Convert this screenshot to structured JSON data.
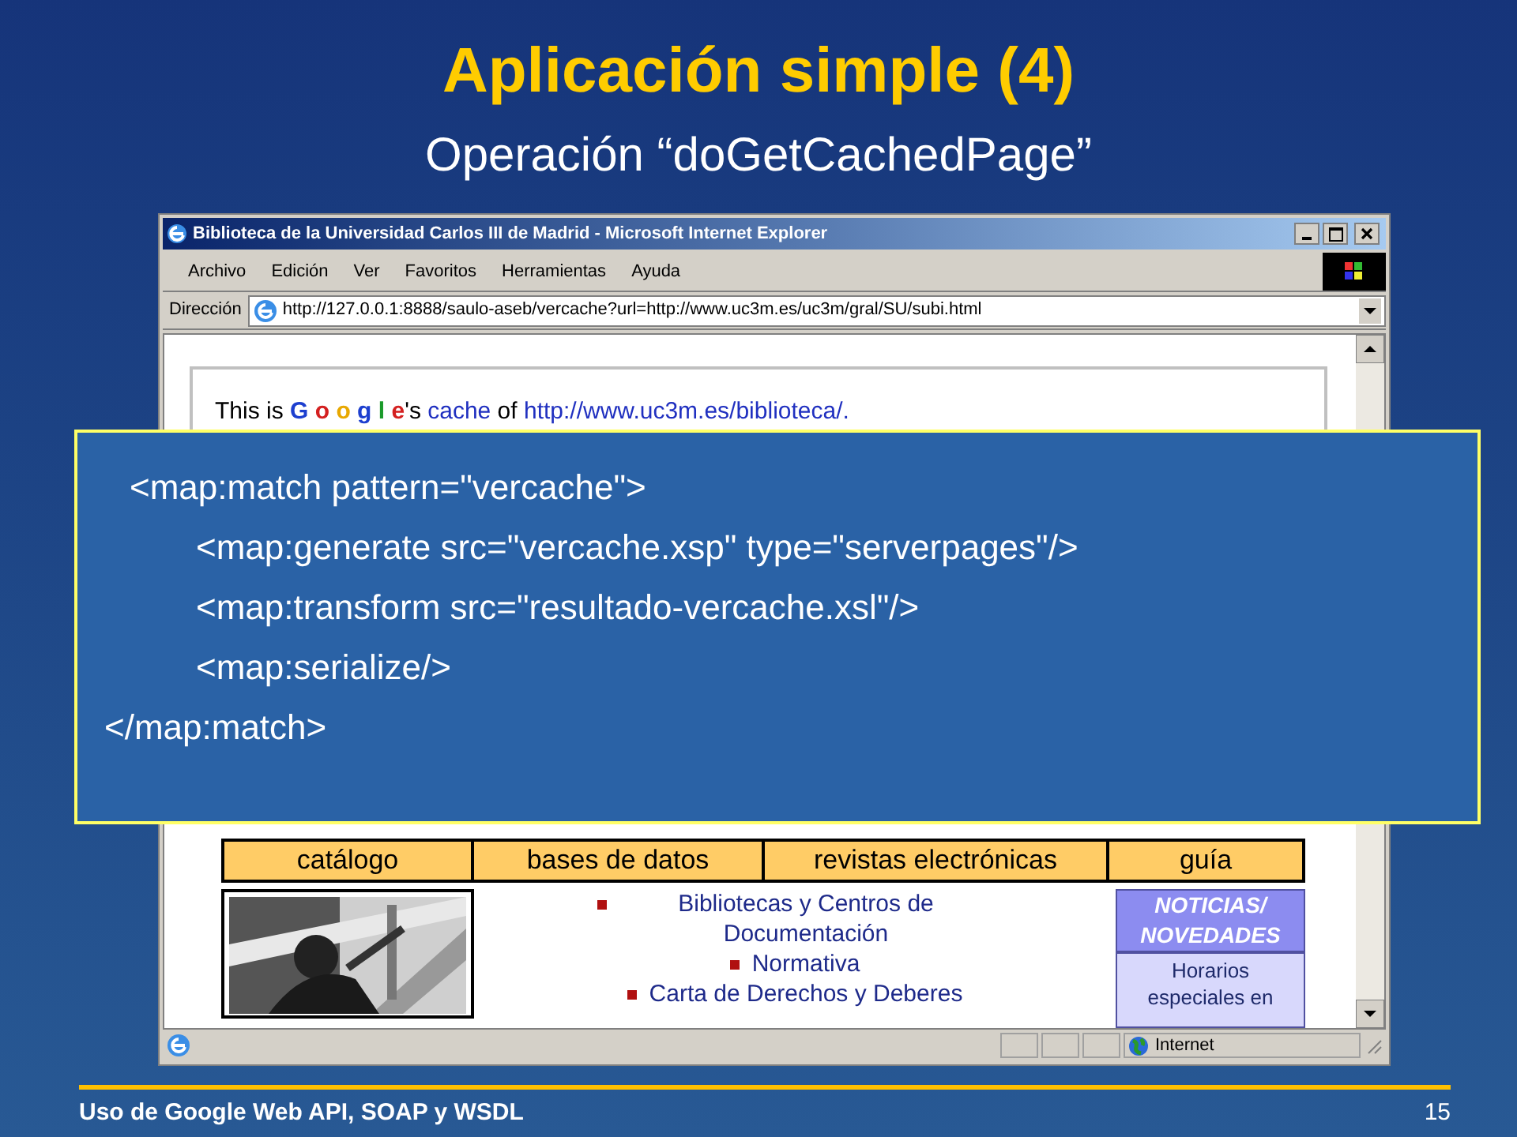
{
  "slide": {
    "title": "Aplicación simple (4)",
    "subtitle": "Operación “doGetCachedPage”"
  },
  "browser": {
    "title": "Biblioteca de la Universidad Carlos III de Madrid - Microsoft Internet Explorer",
    "menu": [
      "Archivo",
      "Edición",
      "Ver",
      "Favoritos",
      "Herramientas",
      "Ayuda"
    ],
    "address_label": "Dirección",
    "address": "http://127.0.0.1:8888/saulo-aseb/vercache?url=http://www.uc3m.es/uc3m/gral/SU/subi.html",
    "cache_line": {
      "prefix": "This is",
      "letters": [
        {
          "text": "G",
          "color": "#1d3fcf"
        },
        {
          "text": "o",
          "color": "#d42020"
        },
        {
          "text": "o",
          "color": "#e8a800"
        },
        {
          "text": "g",
          "color": "#1d3fcf"
        },
        {
          "text": "l",
          "color": "#1a9a2a"
        },
        {
          "text": "e",
          "color": "#d42020"
        }
      ],
      "suffix": "'s",
      "link": "cache",
      "middle": "of",
      "url": "http://www.uc3m.es/biblioteca/."
    },
    "nav_tabs": [
      "catálogo",
      "bases de datos",
      "revistas electrónicas",
      "guía"
    ],
    "links": [
      "Bibliotecas y Centros de Documentación",
      "Normativa",
      "Carta de Derechos y Deberes"
    ],
    "news": {
      "heading": "NOTICIAS/ NOVEDADES",
      "text": "Horarios especiales en"
    },
    "status_zone": "Internet"
  },
  "code": {
    "open": "<map:match pattern=\"vercache\">",
    "children": [
      "<map:generate src=\"vercache.xsp\" type=\"serverpages\"/>",
      "<map:transform src=\"resultado-vercache.xsl\"/>",
      "<map:serialize/>"
    ],
    "close": "</map:match>"
  },
  "footer": {
    "text": "Uso de Google Web API, SOAP y WSDL",
    "page": "15"
  }
}
